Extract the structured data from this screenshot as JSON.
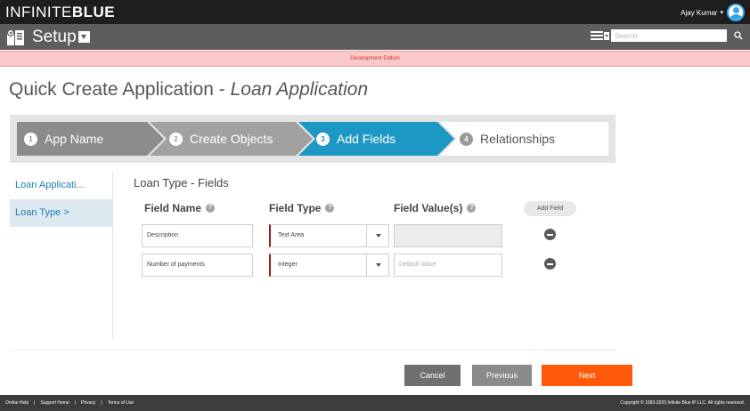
{
  "header": {
    "logo_part1": "INFINITE",
    "logo_part2": "BLUE",
    "user_name": "Ajay Kumar",
    "user_caret": "▾"
  },
  "setup_bar": {
    "title": "Setup",
    "search_placeholder": "Search"
  },
  "banner": {
    "text": "Development Edition"
  },
  "page": {
    "title_prefix": "Quick Create Application - ",
    "title_app": "Loan Application"
  },
  "wizard": {
    "steps": [
      {
        "num": "1",
        "label": "App Name",
        "state": "done"
      },
      {
        "num": "2",
        "label": "Create Objects",
        "state": "done"
      },
      {
        "num": "3",
        "label": "Add Fields",
        "state": "active"
      },
      {
        "num": "4",
        "label": "Relationships",
        "state": "pending"
      }
    ]
  },
  "left_nav": {
    "items": [
      {
        "label": "Loan Applicati...",
        "active": false
      },
      {
        "label": "Loan Type >",
        "active": true
      }
    ]
  },
  "fields_section": {
    "title": "Loan Type - Fields",
    "columns": {
      "field_name": "Field Name",
      "field_type": "Field Type",
      "field_values": "Field Value(s)"
    },
    "help_glyph": "?",
    "add_field_label": "Add Field",
    "rows": [
      {
        "name": "Description",
        "type": "Text Area",
        "value": "",
        "value_placeholder": "",
        "value_disabled": true
      },
      {
        "name": "Number of payments",
        "type": "Integer",
        "value": "",
        "value_placeholder": "Default Value",
        "value_disabled": false
      }
    ]
  },
  "actions": {
    "cancel": "Cancel",
    "previous": "Previous",
    "next": "Next"
  },
  "footer": {
    "links": [
      "Online Help",
      "Support Home",
      "Privacy",
      "Terms of Use"
    ],
    "separator": "|",
    "copyright": "Copyright © 1993-2020 Infinite Blue IP LLC. All rights reserved."
  },
  "colors": {
    "accent_blue": "#1d98c4",
    "next_orange": "#ff5a0a",
    "banner_bg": "#f9c9c9",
    "required_marker": "#9b1c1c"
  }
}
